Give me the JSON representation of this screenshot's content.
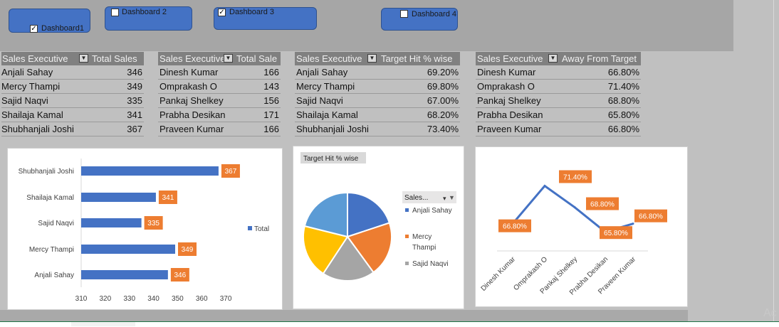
{
  "buttons": [
    {
      "label": "Dashboard1",
      "checked": true
    },
    {
      "label": "Dashboard 2",
      "checked": false
    },
    {
      "label": "Dashboard 3",
      "checked": true
    },
    {
      "label": "Dashboard 4",
      "checked": false
    }
  ],
  "tables": [
    {
      "col1": "Sales Executive",
      "col2": "Total Sales",
      "rows": [
        {
          "name": "Anjali Sahay",
          "value": "346"
        },
        {
          "name": "Mercy Thampi",
          "value": "349"
        },
        {
          "name": "Sajid Naqvi",
          "value": "335"
        },
        {
          "name": "Shailaja Kamal",
          "value": "341"
        },
        {
          "name": "Shubhanjali Joshi",
          "value": "367"
        }
      ]
    },
    {
      "col1": "Sales Executive",
      "col2": "Total Sale",
      "rows": [
        {
          "name": "Dinesh Kumar",
          "value": "166"
        },
        {
          "name": "Omprakash O",
          "value": "143"
        },
        {
          "name": "Pankaj Shelkey",
          "value": "156"
        },
        {
          "name": "Prabha Desikan",
          "value": "171"
        },
        {
          "name": "Praveen Kumar",
          "value": "166"
        }
      ]
    },
    {
      "col1": "Sales Executive",
      "col2": "Target Hit % wise",
      "rows": [
        {
          "name": "Anjali Sahay",
          "value": "69.20%"
        },
        {
          "name": "Mercy Thampi",
          "value": "69.80%"
        },
        {
          "name": "Sajid Naqvi",
          "value": "67.00%"
        },
        {
          "name": "Shailaja Kamal",
          "value": "68.20%"
        },
        {
          "name": "Shubhanjali Joshi",
          "value": "73.40%"
        }
      ]
    },
    {
      "col1": "Sales Executive",
      "col2": "Away From Target",
      "rows": [
        {
          "name": "Dinesh Kumar",
          "value": "66.80%"
        },
        {
          "name": "Omprakash O",
          "value": "71.40%"
        },
        {
          "name": "Pankaj Shelkey",
          "value": "68.80%"
        },
        {
          "name": "Prabha Desikan",
          "value": "65.80%"
        },
        {
          "name": "Praveen Kumar",
          "value": "66.80%"
        }
      ]
    }
  ],
  "watermark": "Ac",
  "colors": {
    "bar_fill": "#4472c4",
    "label_fill": "#ed7d31",
    "button_fill": "#4472c4",
    "line_color": "#4472c4"
  },
  "chart_data": [
    {
      "type": "bar",
      "orientation": "horizontal",
      "categories": [
        "Shubhanjali Joshi",
        "Shailaja Kamal",
        "Sajid Naqvi",
        "Mercy Thampi",
        "Anjali Sahay"
      ],
      "values": [
        367,
        341,
        335,
        349,
        346
      ],
      "data_labels": [
        "367",
        "341",
        "335",
        "349",
        "346"
      ],
      "series": [
        {
          "name": "Total",
          "values": [
            367,
            341,
            335,
            349,
            346
          ]
        }
      ],
      "legend": "Total",
      "xlim": [
        310,
        375
      ],
      "xticks": [
        "310",
        "320",
        "330",
        "340",
        "350",
        "360",
        "370"
      ],
      "grid": false,
      "legend_position": "right"
    },
    {
      "type": "pie",
      "field_button": "Target Hit  % wise",
      "legend_filter": "Sales...",
      "legend": [
        "Anjali Sahay",
        "Mercy Thampi",
        "Sajid Naqvi"
      ],
      "slices": [
        {
          "name": "Anjali Sahay",
          "value": 69.2,
          "color": "#4472c4"
        },
        {
          "name": "Mercy Thampi",
          "value": 69.8,
          "color": "#ed7d31"
        },
        {
          "name": "Sajid Naqvi",
          "value": 67.0,
          "color": "#a5a5a5"
        },
        {
          "name": "Shailaja Kamal",
          "value": 68.2,
          "color": "#ffc000"
        },
        {
          "name": "Shubhanjali Joshi",
          "value": 73.4,
          "color": "#5b9bd5"
        }
      ],
      "legend_position": "right"
    },
    {
      "type": "line",
      "categories": [
        "Dinesh Kumar",
        "Omprakash O",
        "Pankaj Shelkey",
        "Prabha Desikan",
        "Praveen Kumar"
      ],
      "values": [
        66.8,
        71.4,
        68.8,
        65.8,
        66.8
      ],
      "data_labels": [
        "66.80%",
        "71.40%",
        "68.80%",
        "65.80%",
        "66.80%"
      ],
      "ylim": [
        64,
        73
      ],
      "grid": false
    }
  ]
}
